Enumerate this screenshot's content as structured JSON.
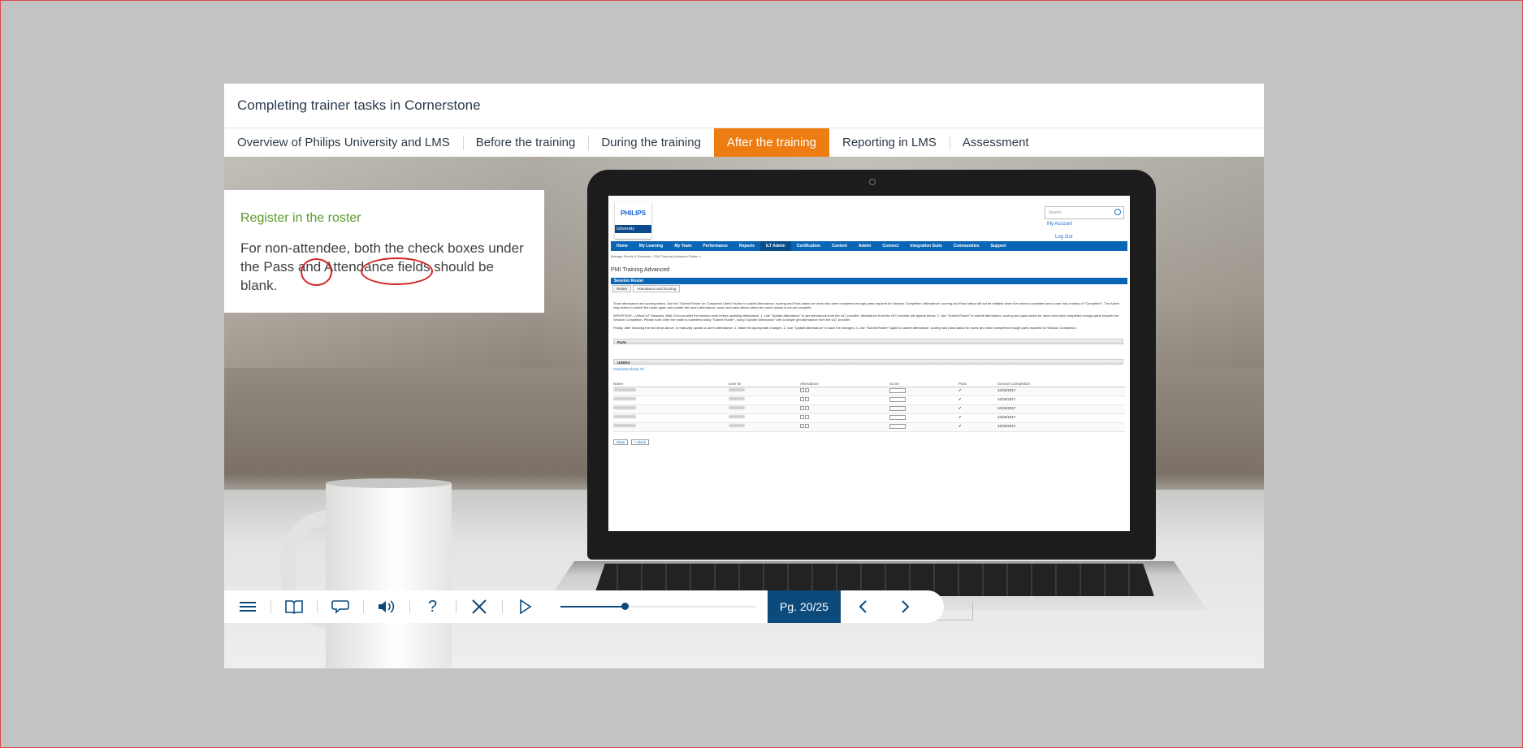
{
  "course_title": "Completing trainer tasks in Cornerstone",
  "tabs": [
    {
      "label": "Overview of Philips University and LMS",
      "active": false
    },
    {
      "label": "Before the training",
      "active": false
    },
    {
      "label": "During the training",
      "active": false
    },
    {
      "label": "After the training",
      "active": true
    },
    {
      "label": "Reporting in LMS",
      "active": false
    },
    {
      "label": "Assessment",
      "active": false
    }
  ],
  "colors": {
    "accent_tab": "#ed7d12",
    "heading_green": "#5c9a2c",
    "control_blue": "#0c4a7c",
    "annotation_red": "#d32424"
  },
  "callout": {
    "heading": "Register in the roster",
    "body": "For non-attendee, both the check boxes under the Pass and Attendance fields should be blank."
  },
  "screen": {
    "logo_brand": "PHILIPS",
    "logo_sub": "University",
    "search_placeholder": "Search",
    "my_account": "My Account",
    "log_out": "Log Out",
    "nav": [
      "Home",
      "My Learning",
      "My Team",
      "Performance",
      "Reports",
      "ILT Admin",
      "Certification",
      "Content",
      "Admin",
      "Connect",
      "Integration Suite",
      "Communities",
      "Support"
    ],
    "nav_active": "ILT Admin",
    "breadcrumb": "Manage Events & Sessions  >  PMI Training Advanced Roster  >",
    "page_title": "PMI Training Advanced",
    "session_bar": "Session Roster",
    "sub_tabs": [
      "Roster",
      "Attendance and Scoring"
    ],
    "paragraph_1": "Track attendance and scoring below. Use the \"Submit Roster for Completed Users\" button to submit Attendance, scoring and Pass status for users who have completed enough parts required for Session Completion. Attendance, scoring and Pass status will not be editable when the roster is submitted and a user has a status of \"Completed\". The Admin may select to submit the roster again and update the user's attendance, score and pass status where the user's status is not yet complete.",
    "paragraph_2": "IMPORTANT—Virtual ILT Sessions: Wait 24 hours after the session ends before updating attendance. 1. Use \"Update Attendance\" to get attendance from the vILT provider. Attendance from the vILT provider will appear below. 2. Use \"Submit Roster\" to submit attendance, scoring and pass status for users who have completed enough parts required for Session Completion. Please note: After the roster is submitted using \"Submit Roster\", using \"Update Attendance\" will no longer get attendance from the vILT provider.",
    "paragraph_3": "Finally, after following the two steps above, to manually update a user's attendance: 1. Make the appropriate changes. 2. Use \"Update Attendance\" to save the changes. 3. Use \"Submit Roster\" again to submit attendance, scoring and pass status for users who have completed enough parts required for Session Completion.",
    "parts_label": "Parts",
    "users_label": "USERS",
    "check_all": "Check/Uncheck All",
    "columns": [
      "Name",
      "User ID",
      "Attendance",
      "Score",
      "Pass",
      "Session Completion"
    ],
    "rows": [
      {
        "score": "0",
        "completion": "10/25/2017"
      },
      {
        "score": "0",
        "completion": "10/25/2017"
      },
      {
        "score": "0",
        "completion": "10/25/2017"
      },
      {
        "score": "0",
        "completion": "10/25/2017"
      },
      {
        "score": "0",
        "completion": "10/25/2017"
      }
    ],
    "save_label": "Save",
    "back_label": "« Back"
  },
  "player": {
    "icons": [
      "menu-icon",
      "book-icon",
      "speech-bubble-icon",
      "volume-icon",
      "help-icon",
      "close-icon",
      "play-icon"
    ],
    "help_glyph": "?",
    "progress_fraction": 0.33,
    "page_label": "Pg. 20/25"
  }
}
